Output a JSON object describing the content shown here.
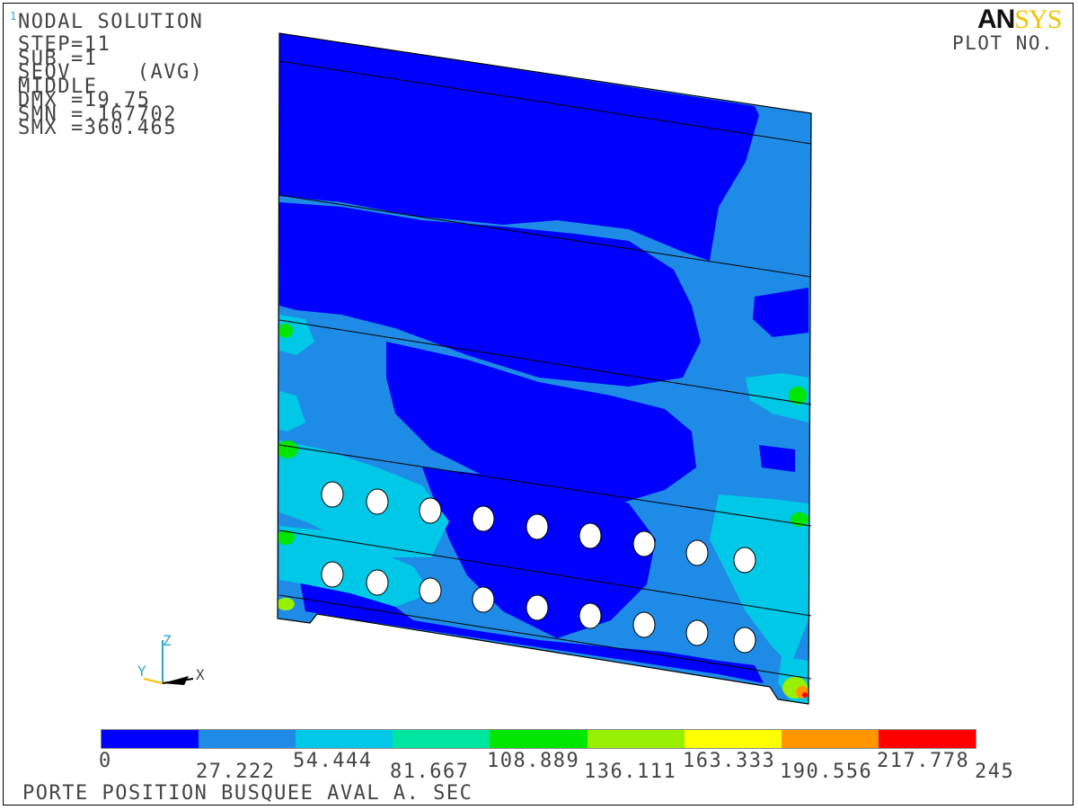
{
  "window_number": "1",
  "info_lines": [
    "NODAL SOLUTION",
    "STEP=11",
    "SUB =1",
    "SEQV     (AVG)",
    "MIDDLE",
    "DMX =19.75",
    "SMN =.167702",
    "SMX =360.465"
  ],
  "logo": {
    "part1": "AN",
    "part2": "SYS"
  },
  "plot_label": "PLOT NO.",
  "axes": {
    "z": "Z",
    "y": "Y",
    "x": "X"
  },
  "legend": {
    "colors": [
      "#0000ff",
      "#1e8ce6",
      "#00c8e6",
      "#00e6a0",
      "#00e600",
      "#96f000",
      "#ffff00",
      "#ff9600",
      "#ff0000"
    ],
    "ticks": [
      "0",
      "27.222",
      "54.444",
      "81.667",
      "108.889",
      "136.111",
      "163.333",
      "190.556",
      "217.778",
      "245"
    ]
  },
  "caption": "PORTE POSITION BUSQUEE AVAL A. SEC",
  "colors": {
    "min": "#0000ff",
    "low": "#1e8ce6",
    "mid": "#00c8e6",
    "high": "#00e600"
  }
}
